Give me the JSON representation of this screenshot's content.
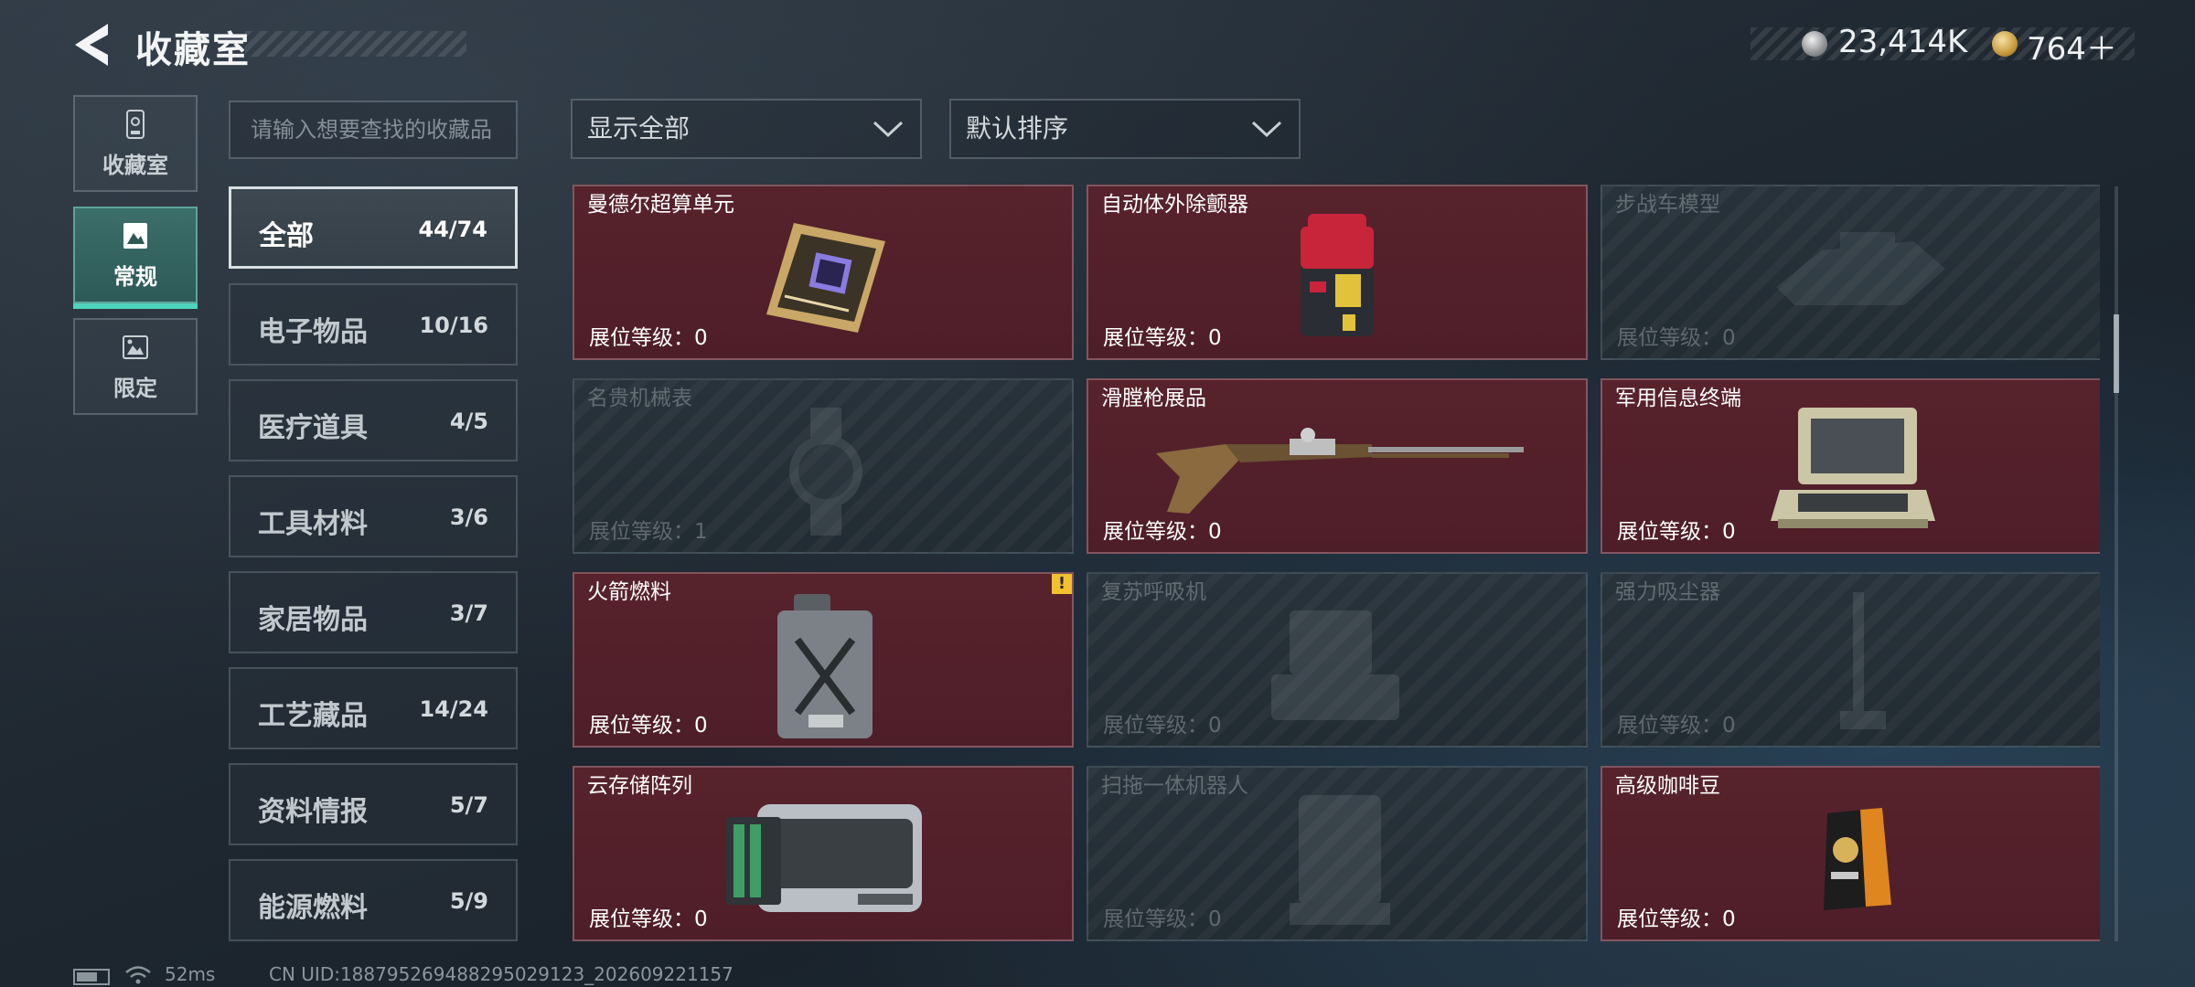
{
  "header": {
    "title": "收藏室",
    "currency_silver": "23,414K",
    "currency_gold": "764＋"
  },
  "side_tabs": [
    {
      "label": "收藏室",
      "icon": "trophy-icon",
      "active": false
    },
    {
      "label": "常规",
      "icon": "image-frame-icon",
      "active": true
    },
    {
      "label": "限定",
      "icon": "limited-image-icon",
      "active": false
    }
  ],
  "search": {
    "placeholder": "请输入想要查找的收藏品"
  },
  "filters": {
    "show": "显示全部",
    "sort": "默认排序"
  },
  "categories": [
    {
      "name": "全部",
      "count": "44/74",
      "active": true
    },
    {
      "name": "电子物品",
      "count": "10/16",
      "active": false
    },
    {
      "name": "医疗道具",
      "count": "4/5",
      "active": false
    },
    {
      "name": "工具材料",
      "count": "3/6",
      "active": false
    },
    {
      "name": "家居物品",
      "count": "3/7",
      "active": false
    },
    {
      "name": "工艺藏品",
      "count": "14/24",
      "active": false
    },
    {
      "name": "资料情报",
      "count": "5/7",
      "active": false
    },
    {
      "name": "能源燃料",
      "count": "5/9",
      "active": false
    }
  ],
  "items": [
    {
      "name": "曼德尔超算单元",
      "level": "展位等级：0",
      "owned": true,
      "art": "supercomputer-chip"
    },
    {
      "name": "自动体外除颤器",
      "level": "展位等级：0",
      "owned": true,
      "art": "defibrillator"
    },
    {
      "name": "步战车模型",
      "level": "展位等级：0",
      "owned": false,
      "art": "ifv-model"
    },
    {
      "name": "名贵机械表",
      "level": "展位等级：1",
      "owned": false,
      "art": "watch"
    },
    {
      "name": "滑膛枪展品",
      "level": "展位等级：0",
      "owned": true,
      "art": "musket"
    },
    {
      "name": "军用信息终端",
      "level": "展位等级：0",
      "owned": true,
      "art": "military-terminal"
    },
    {
      "name": "火箭燃料",
      "level": "展位等级：0",
      "owned": true,
      "art": "fuel-can",
      "badge": "!"
    },
    {
      "name": "复苏呼吸机",
      "level": "展位等级：0",
      "owned": false,
      "art": "ventilator"
    },
    {
      "name": "强力吸尘器",
      "level": "展位等级：0",
      "owned": false,
      "art": "vacuum"
    },
    {
      "name": "云存储阵列",
      "level": "展位等级：0",
      "owned": true,
      "art": "storage-array"
    },
    {
      "name": "扫拖一体机器人",
      "level": "展位等级：0",
      "owned": false,
      "art": "mop-robot"
    },
    {
      "name": "高级咖啡豆",
      "level": "展位等级：0",
      "owned": true,
      "art": "coffee-bag"
    }
  ],
  "status": {
    "ping": "52ms",
    "uid": "CN UID:188795269488295029123_202609221157"
  },
  "colors": {
    "owned_card": "#57222c",
    "active_tab": "#3c6e6a",
    "accent": "#4fd3bd",
    "badge": "#f2c12e"
  }
}
